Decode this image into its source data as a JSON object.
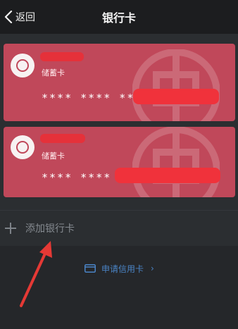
{
  "header": {
    "back_label": "返回",
    "title": "银行卡"
  },
  "cards": [
    {
      "type": "储蓄卡",
      "number_masked": "**** **** ****"
    },
    {
      "type": "储蓄卡",
      "number_masked": "**** **** ****"
    }
  ],
  "actions": {
    "add_card_label": "添加银行卡",
    "apply_credit_label": "申请信用卡",
    "apply_chevron": "›"
  },
  "colors": {
    "card_red": "#c0485a",
    "redact_red": "#e5313a",
    "link_blue": "#4a84c6",
    "annotation_red": "#e53935"
  },
  "icons": {
    "back": "chevron-left-icon",
    "bank_logo": "bank-logo-icon",
    "add": "plus-icon",
    "credit_card": "credit-card-icon"
  }
}
